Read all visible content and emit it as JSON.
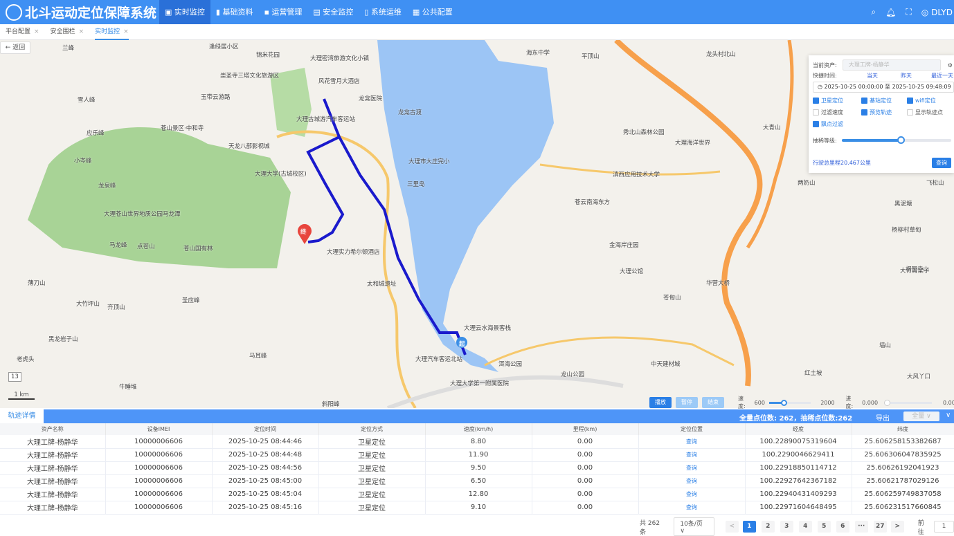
{
  "app": {
    "title": "北斗运动定位保障系统",
    "user": "DLYD"
  },
  "nav": [
    {
      "label": "实时监控",
      "icon": "monitor-icon",
      "active": true
    },
    {
      "label": "基础资料",
      "icon": "book-icon"
    },
    {
      "label": "运营管理",
      "icon": "grid-icon"
    },
    {
      "label": "安全监控",
      "icon": "shield-icon"
    },
    {
      "label": "系统运维",
      "icon": "tool-icon"
    },
    {
      "label": "公共配置",
      "icon": "config-icon"
    }
  ],
  "tabs": [
    {
      "label": "平台配置"
    },
    {
      "label": "安全围栏"
    },
    {
      "label": "实时监控",
      "active": true
    }
  ],
  "map": {
    "back_label": "← 返回",
    "start_marker": "起",
    "end_marker": "终",
    "scale": "1 km",
    "zoom": "13",
    "labels": [
      "兰峰",
      "逢绿居小区",
      "锦米花园",
      "大理密湾旅游文化小镇",
      "崇圣寺三塔文化旅游区",
      "玉带云游路",
      "雪人峰",
      "应乐峰",
      "苍山景区·中和寺",
      "天龙八部影视城",
      "风花雪月大酒店",
      "龙龛医院",
      "龙龛古渡",
      "大理古城游汽车客运站",
      "大理大学(古城校区)",
      "大理市大庄完小",
      "三里岛",
      "小岑峰",
      "龙泉峰",
      "大理苍山世界地质公园马龙潭",
      "马龙峰",
      "点苍山",
      "苍山国有林",
      "圣应峰",
      "大理实力希尔顿酒店",
      "太和城遗址",
      "大理汽车客运北站",
      "大理云水海景客栈",
      "洱海公园",
      "龙山公园",
      "大理大学第一附属医院",
      "海东中学",
      "平顶山",
      "龙头村北山",
      "秀北山森林公园",
      "大理海洋世界",
      "滇西应用技术大学",
      "苍云南海东方",
      "金海岸庄园",
      "大理公馆",
      "大青山",
      "两奶山",
      "飞松山",
      "黑泥塘",
      "杨柳村草甸",
      "相国寺山",
      "大竹箐梁子",
      "苍甸山",
      "华营大桥",
      "中天建材城",
      "红土坡",
      "大风丫口",
      "墙山",
      "马耳峰",
      "牛睡堆",
      "斜阳峰",
      "老虎头",
      "黑龙岩子山",
      "薄刀山",
      "大竹坪山",
      "齐顶山",
      "上甲塘"
    ]
  },
  "panel": {
    "asset_label": "当前资产:",
    "asset_placeholder": "大理工牌-杨静华",
    "quick_label": "快捷时间:",
    "quick": [
      "当天",
      "昨天",
      "最近一天"
    ],
    "start": "2025-10-25 00:00:00",
    "sep": "至",
    "end": "2025-10-25 09:48:09",
    "checks": [
      {
        "label": "卫星定位",
        "checked": true
      },
      {
        "label": "基站定位",
        "checked": true
      },
      {
        "label": "wifi定位",
        "checked": true
      },
      {
        "label": "过滤速度",
        "checked": false
      },
      {
        "label": "预览轨迹",
        "checked": true
      },
      {
        "label": "显示轨迹点",
        "checked": false
      },
      {
        "label": "飘点过滤",
        "checked": true
      }
    ],
    "level_label": "抽稀等级:",
    "level": 0.54,
    "mileage": "行驶总里程20.467公里",
    "query": "查询"
  },
  "playback": {
    "play": "播放",
    "pause": "暂停",
    "stop": "结束",
    "speed_label": "速度:",
    "speed_min": "600",
    "speed_max": "2000",
    "speed": 0.1,
    "progress_label": "进度:",
    "progress": "0.000",
    "progress_max": "0.000"
  },
  "detail": {
    "tab": "轨迹详情",
    "summary": "全量点位数: 262，抽稀点位数:262",
    "export": "导出",
    "select": "全量 ∨",
    "collapse": "∨"
  },
  "table": {
    "columns": [
      "资产名称",
      "设备IMEI",
      "定位时间",
      "定位方式",
      "速度(km/h)",
      "里程(km)",
      "定位位置",
      "经度",
      "纬度"
    ],
    "rows": [
      [
        "大理工牌-杨静华",
        "10000006606",
        "2025-10-25 08:44:46",
        "卫星定位",
        "8.80",
        "0.00",
        "查询",
        "100.22890075319604",
        "25.606258153382687"
      ],
      [
        "大理工牌-杨静华",
        "10000006606",
        "2025-10-25 08:44:48",
        "卫星定位",
        "11.90",
        "0.00",
        "查询",
        "100.2290046629411",
        "25.606306047835925"
      ],
      [
        "大理工牌-杨静华",
        "10000006606",
        "2025-10-25 08:44:56",
        "卫星定位",
        "9.50",
        "0.00",
        "查询",
        "100.22918850114712",
        "25.60626192041923"
      ],
      [
        "大理工牌-杨静华",
        "10000006606",
        "2025-10-25 08:45:00",
        "卫星定位",
        "6.50",
        "0.00",
        "查询",
        "100.22927642367182",
        "25.60621787029126"
      ],
      [
        "大理工牌-杨静华",
        "10000006606",
        "2025-10-25 08:45:04",
        "卫星定位",
        "12.80",
        "0.00",
        "查询",
        "100.22940431409293",
        "25.606259749837058"
      ],
      [
        "大理工牌-杨静华",
        "10000006606",
        "2025-10-25 08:45:16",
        "卫星定位",
        "9.10",
        "0.00",
        "查询",
        "100.22971604648495",
        "25.606231517660845"
      ]
    ]
  },
  "pagination": {
    "total": "共 262 条",
    "size": "10条/页 ∨",
    "prev": "<",
    "pages": [
      "1",
      "2",
      "3",
      "4",
      "5",
      "6",
      "···",
      "27"
    ],
    "next": ">",
    "goto": "前往",
    "page": "1"
  }
}
